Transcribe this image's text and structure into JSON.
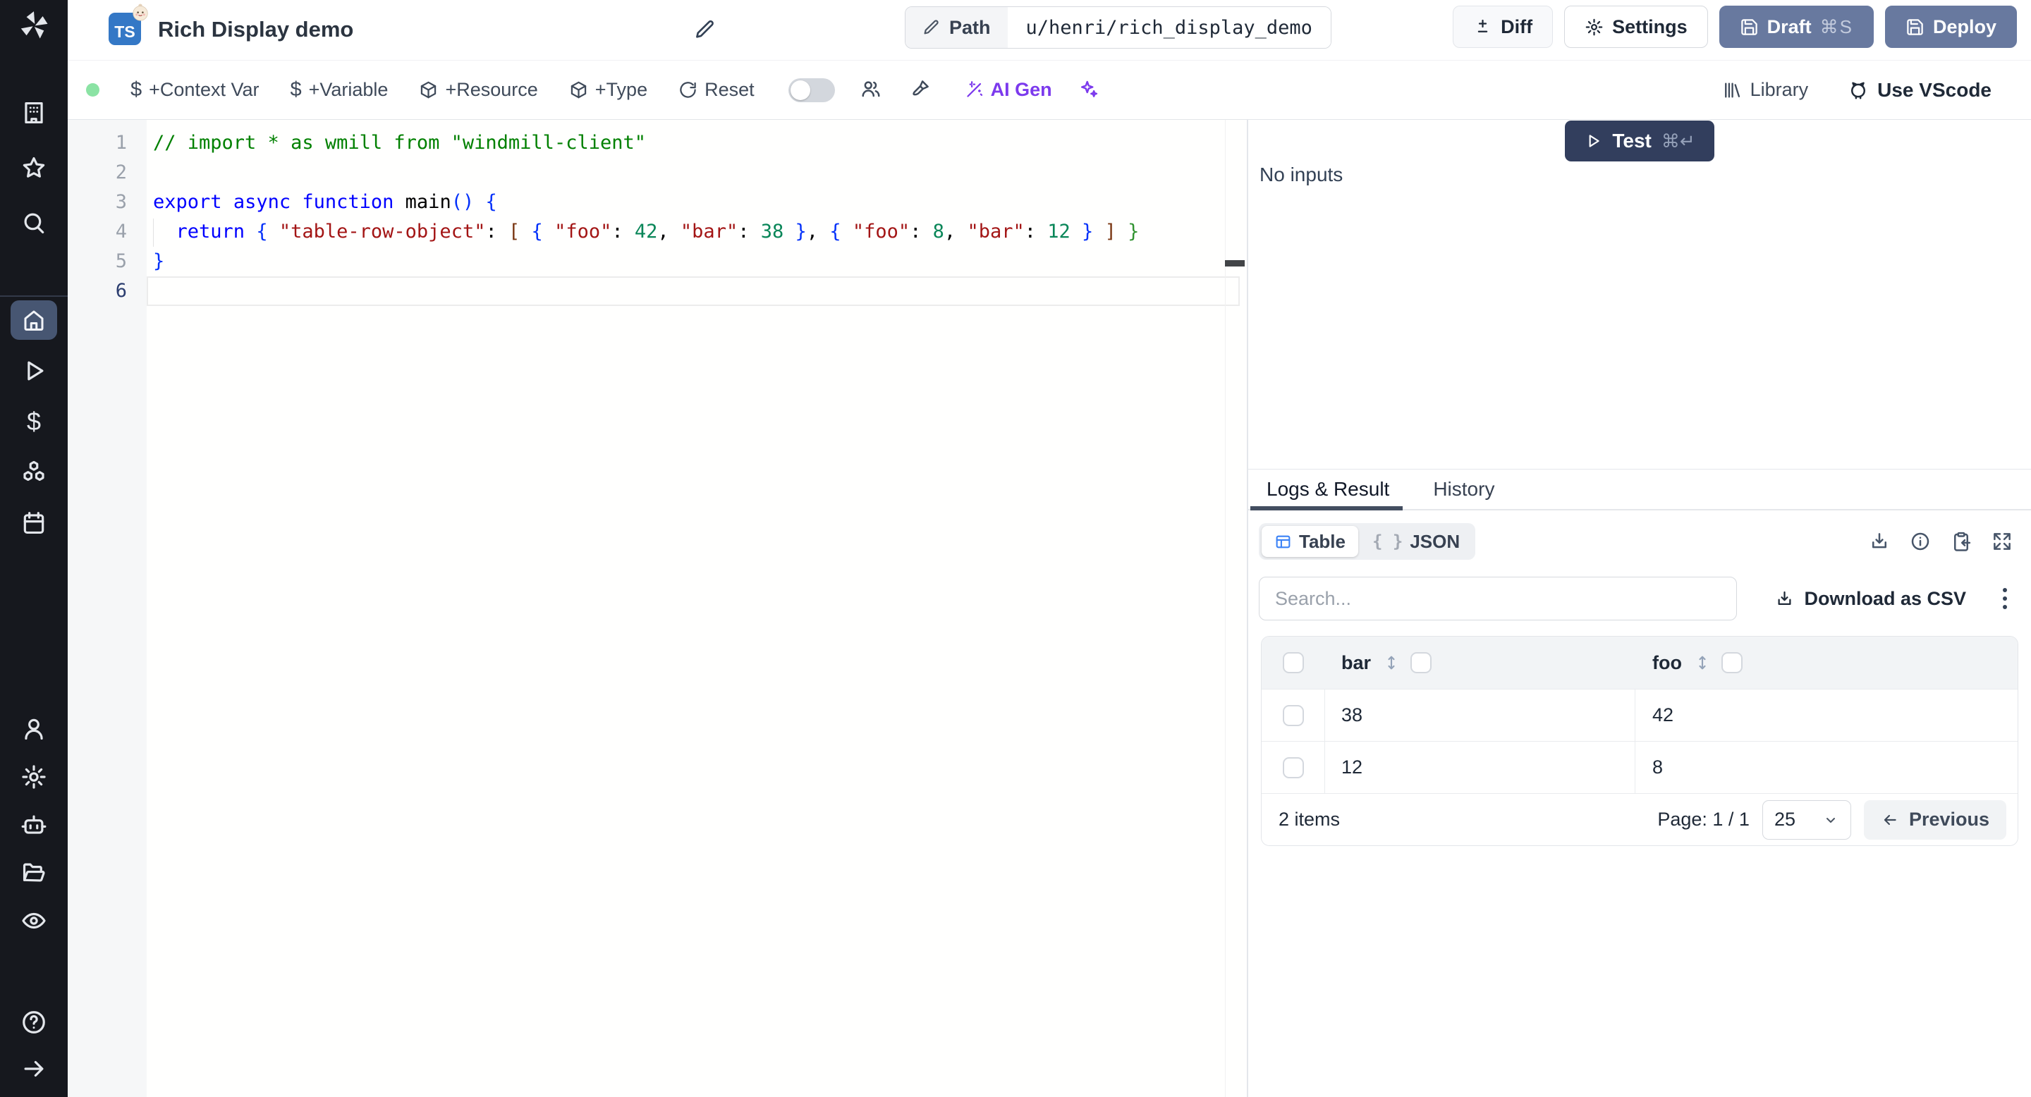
{
  "sidebar": {
    "icons_top": [
      "windmill-logo",
      "building",
      "star",
      "search"
    ],
    "icons_main": [
      "home",
      "play",
      "dollar",
      "cubes",
      "calendar"
    ],
    "active_item": "home",
    "icons_bottom": [
      "user",
      "settings",
      "bot",
      "folder",
      "eye"
    ],
    "icons_footer": [
      "help",
      "collapse-right"
    ]
  },
  "header": {
    "language_badge": "TS",
    "title": "Rich Display demo",
    "path_label": "Path",
    "path_value": "u/henri/rich_display_demo",
    "diff_label": "Diff",
    "settings_label": "Settings",
    "draft_label": "Draft",
    "draft_kbd": "⌘S",
    "deploy_label": "Deploy"
  },
  "toolbar": {
    "context_var": "+Context Var",
    "variable": "+Variable",
    "resource": "+Resource",
    "type": "+Type",
    "reset": "Reset",
    "ai_gen": "AI Gen",
    "library": "Library",
    "use_vscode": "Use VScode",
    "status_dot_color": "#8be3a4",
    "ai_accent_color": "#7c3aed"
  },
  "editor": {
    "line_numbers": [
      "1",
      "2",
      "3",
      "4",
      "5",
      "6"
    ],
    "active_line": 6,
    "lines": [
      [
        [
          "// import * as wmill from \"windmill-client\"",
          "c"
        ]
      ],
      [],
      [
        [
          "export",
          "k"
        ],
        [
          " ",
          "p"
        ],
        [
          "async",
          "k"
        ],
        [
          " ",
          "p"
        ],
        [
          "function",
          "k"
        ],
        [
          " ",
          "p"
        ],
        [
          "main",
          "p"
        ],
        [
          "(",
          "b"
        ],
        [
          ")",
          "b"
        ],
        [
          " ",
          "p"
        ],
        [
          "{",
          "b"
        ]
      ],
      [
        [
          "  ",
          "p"
        ],
        [
          "return",
          "k"
        ],
        [
          " ",
          "p"
        ],
        [
          "{",
          "b"
        ],
        [
          " ",
          "p"
        ],
        [
          "\"table-row-object\"",
          "s"
        ],
        [
          ":",
          "p"
        ],
        [
          " ",
          "p"
        ],
        [
          "[",
          "r"
        ],
        [
          " ",
          "p"
        ],
        [
          "{",
          "b"
        ],
        [
          " ",
          "p"
        ],
        [
          "\"foo\"",
          "s"
        ],
        [
          ":",
          "p"
        ],
        [
          " ",
          "p"
        ],
        [
          "42",
          "n"
        ],
        [
          ",",
          "p"
        ],
        [
          " ",
          "p"
        ],
        [
          "\"bar\"",
          "s"
        ],
        [
          ":",
          "p"
        ],
        [
          " ",
          "p"
        ],
        [
          "38",
          "n"
        ],
        [
          " ",
          "p"
        ],
        [
          "}",
          "b"
        ],
        [
          ",",
          "p"
        ],
        [
          " ",
          "p"
        ],
        [
          "{",
          "b"
        ],
        [
          " ",
          "p"
        ],
        [
          "\"foo\"",
          "s"
        ],
        [
          ":",
          "p"
        ],
        [
          " ",
          "p"
        ],
        [
          "8",
          "n"
        ],
        [
          ",",
          "p"
        ],
        [
          " ",
          "p"
        ],
        [
          "\"bar\"",
          "s"
        ],
        [
          ":",
          "p"
        ],
        [
          " ",
          "p"
        ],
        [
          "12",
          "n"
        ],
        [
          " ",
          "p"
        ],
        [
          "}",
          "b"
        ],
        [
          " ",
          "p"
        ],
        [
          "]",
          "r"
        ],
        [
          " ",
          "p"
        ],
        [
          "}",
          "g"
        ]
      ],
      [
        [
          "}",
          "b"
        ]
      ],
      []
    ]
  },
  "run_panel": {
    "test_label": "Test",
    "test_kbd": "⌘↵",
    "no_inputs": "No inputs",
    "test_button_color": "#323e5d"
  },
  "result_panel": {
    "tabs": [
      "Logs & Result",
      "History"
    ],
    "active_tab": "Logs & Result",
    "views": [
      "Table",
      "JSON"
    ],
    "active_view": "Table",
    "action_icons": [
      "download-icon",
      "info-icon",
      "clipboard-import-icon",
      "expand-icon"
    ],
    "search_placeholder": "Search...",
    "download_csv": "Download as CSV",
    "table": {
      "columns": [
        "bar",
        "foo"
      ],
      "rows": [
        [
          "38",
          "42"
        ],
        [
          "12",
          "8"
        ]
      ]
    },
    "footer": {
      "items_text": "2 items",
      "page_text": "Page: 1 / 1",
      "page_size": "25",
      "previous_label": "Previous"
    }
  }
}
